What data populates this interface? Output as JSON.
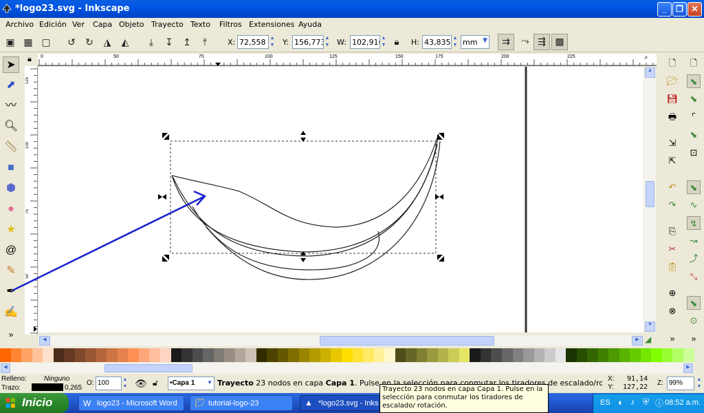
{
  "window": {
    "title": "*logo23.svg - Inkscape"
  },
  "menu": [
    "Archivo",
    "Edición",
    "Ver",
    "Capa",
    "Objeto",
    "Trayecto",
    "Texto",
    "Filtros",
    "Extensiones",
    "Ayuda"
  ],
  "toolbar": {
    "x_label": "X:",
    "x_value": "72,558",
    "y_label": "Y:",
    "y_value": "156,773",
    "w_label": "W:",
    "w_value": "102,916",
    "h_label": "H:",
    "h_value": "43,835",
    "unit": "mm"
  },
  "ruler": {
    "h_ticks": [
      "0",
      "50",
      "75",
      "100",
      "125",
      "150",
      "175",
      "200",
      "225"
    ],
    "v_ticks": [
      "125",
      "100",
      "75",
      "50"
    ]
  },
  "palette": [
    "#ff6600",
    "#ff8533",
    "#ffa366",
    "#ffc299",
    "#ffe0cc",
    "#4d2b1a",
    "#663a22",
    "#80482b",
    "#995733",
    "#b3653c",
    "#cc7444",
    "#e6824d",
    "#ff9155",
    "#ffa77a",
    "#ffbe9e",
    "#ffd4c2",
    "#1a1a1a",
    "#333333",
    "#4d4d4d",
    "#666666",
    "#807a74",
    "#998e85",
    "#b3a79c",
    "#ccc1b6",
    "#332b00",
    "#4d4200",
    "#665800",
    "#806e00",
    "#998500",
    "#b39b00",
    "#ccb100",
    "#e6c700",
    "#ffde00",
    "#ffe433",
    "#ffeb66",
    "#fff199",
    "#fff8cc",
    "#4d4d1a",
    "#666626",
    "#808033",
    "#99993f",
    "#b3b34d",
    "#cccc59",
    "#e6e666",
    "#1a1a1a",
    "#333333",
    "#4d4d4d",
    "#666666",
    "#808080",
    "#999999",
    "#b3b3b3",
    "#cccccc",
    "#e6e6e6",
    "#1a3300",
    "#264d00",
    "#336600",
    "#408000",
    "#4d9900",
    "#59b300",
    "#66cc00",
    "#73e600",
    "#80ff00",
    "#99ff33",
    "#b3ff66",
    "#ccff99"
  ],
  "status": {
    "fill_label": "Relleno:",
    "fill_value": "Ninguno",
    "stroke_label": "Trazo:",
    "stroke_value": "0,265",
    "opacity_label": "O:",
    "opacity_value": "100",
    "layer": "•Capa 1",
    "msg_bold": "Trayecto",
    "msg_text": "23 nodos en capa",
    "msg_layer": "Capa 1",
    "msg_tail": ". Pulse en la selección para conmutar los tiradores de escalado/rotación.",
    "x_label": "X:",
    "x_value": "91,14",
    "y_label": "Y:",
    "y_value": "127,22",
    "z_label": "Z:",
    "zoom": "99%"
  },
  "tooltip": {
    "text": "Trayecto 23 nodos en capa Capa 1. Pulse en la selección para conmutar los tiradores de escalado/ rotación."
  },
  "taskbar": {
    "start": "Inicio",
    "tasks": [
      "logo23 - Microsoft Word",
      "tutorial-logo-23",
      "*logo23.svg - Inks"
    ],
    "lang": "ES",
    "clock": "08:52 a.m."
  },
  "colors": {
    "accent": "#2233cc",
    "titlebar": "#0055e5",
    "start": "#2e8b2e"
  }
}
